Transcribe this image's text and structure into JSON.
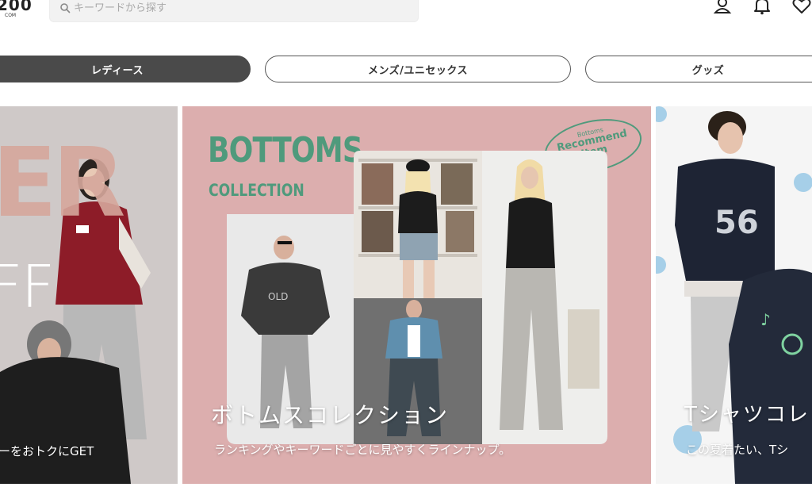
{
  "header": {
    "logo_text": "200",
    "logo_sub": "COM",
    "search_placeholder": "キーワードから探す"
  },
  "tabs": [
    {
      "label": "レディース",
      "active": true
    },
    {
      "label": "メンズ/ユニセックス",
      "active": false
    },
    {
      "label": "グッズ",
      "active": false
    }
  ],
  "banners": {
    "left": {
      "big_text_top": "ER",
      "big_text_mid": "FF",
      "subtitle": "ーをおトクにGET"
    },
    "center": {
      "headline": "BOTTOMS",
      "headline_sub": "COLLECTION",
      "stamp_line1": "Bottoms",
      "stamp_line2": "Recommend",
      "stamp_line3": "Item",
      "title": "ボトムスコレクション",
      "subtitle": "ランキングやキーワードごとに見やすくラインナップ。"
    },
    "right": {
      "title": "Tシャツコレ",
      "subtitle": "この夏着たい、Tシ",
      "shirt_print": "56"
    }
  },
  "colors": {
    "tab_active_bg": "#4a4a4a",
    "banner_center_bg": "#dcaeae",
    "bottoms_green": "#4f9a7c"
  }
}
